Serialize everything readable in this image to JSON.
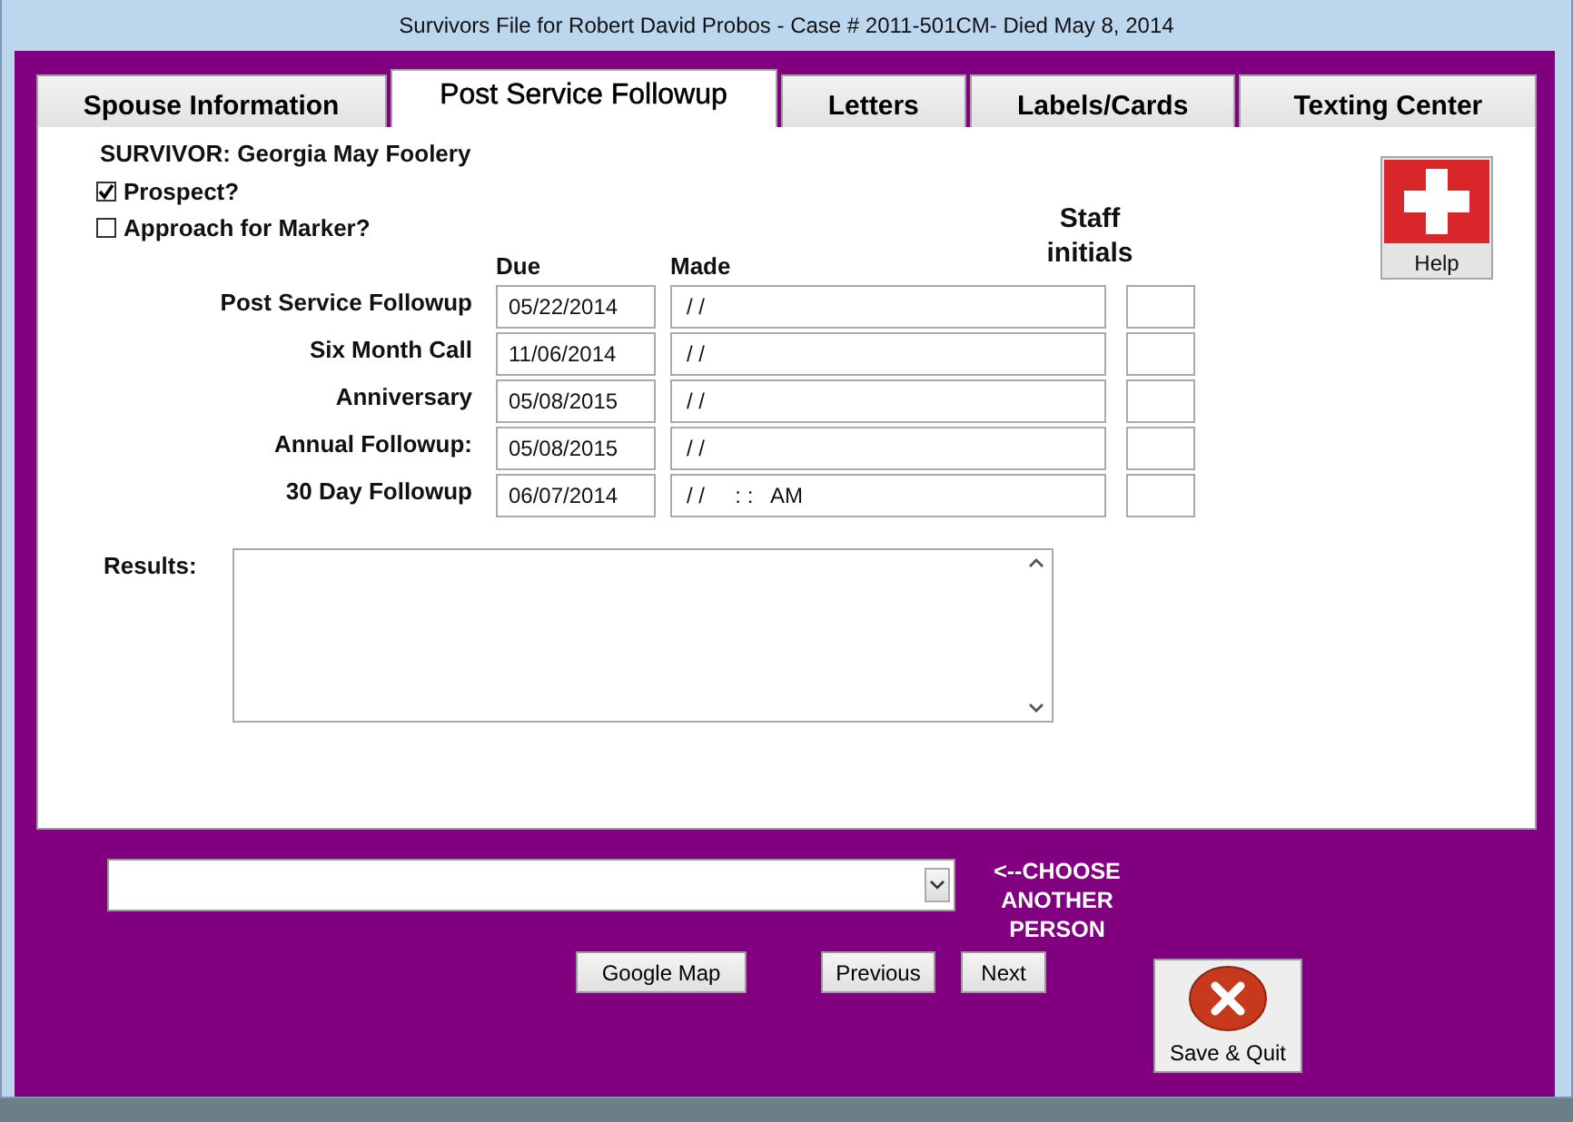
{
  "window": {
    "title": "Survivors File for Robert David Probos - Case # 2011-501CM- Died May 8, 2014"
  },
  "tabs": [
    {
      "label": "Spouse Information",
      "selected": false
    },
    {
      "label": "Post Service Followup",
      "selected": true
    },
    {
      "label": "Letters",
      "selected": false
    },
    {
      "label": "Labels/Cards",
      "selected": false
    },
    {
      "label": "Texting Center",
      "selected": false
    }
  ],
  "survivor": "SURVIVOR: Georgia May Foolery",
  "checkboxes": [
    {
      "label": "Prospect?",
      "checked": true
    },
    {
      "label": "Approach for Marker?",
      "checked": false
    }
  ],
  "columns": {
    "due": "Due",
    "made": "Made",
    "staff": "Staff initials"
  },
  "followups": [
    {
      "label": "Post Service Followup",
      "due": "05/22/2014",
      "made": "/ /"
    },
    {
      "label": "Six Month Call",
      "due": "11/06/2014",
      "made": "/ /"
    },
    {
      "label": "Anniversary",
      "due": "05/08/2015",
      "made": "/ /"
    },
    {
      "label": "Annual Followup:",
      "due": "05/08/2015",
      "made": "/ /"
    },
    {
      "label": "30 Day Followup",
      "due": "06/07/2014",
      "made": "/ /     : :   AM"
    }
  ],
  "help_button": {
    "label": "Help"
  },
  "results": {
    "label": "Results:"
  },
  "person_select": {
    "hint": "<--CHOOSE ANOTHER PERSON"
  },
  "buttons": [
    {
      "label": "Google Map"
    },
    {
      "label": "Previous"
    },
    {
      "label": "Next"
    }
  ],
  "save_quit": {
    "label": "Save & Quit"
  }
}
